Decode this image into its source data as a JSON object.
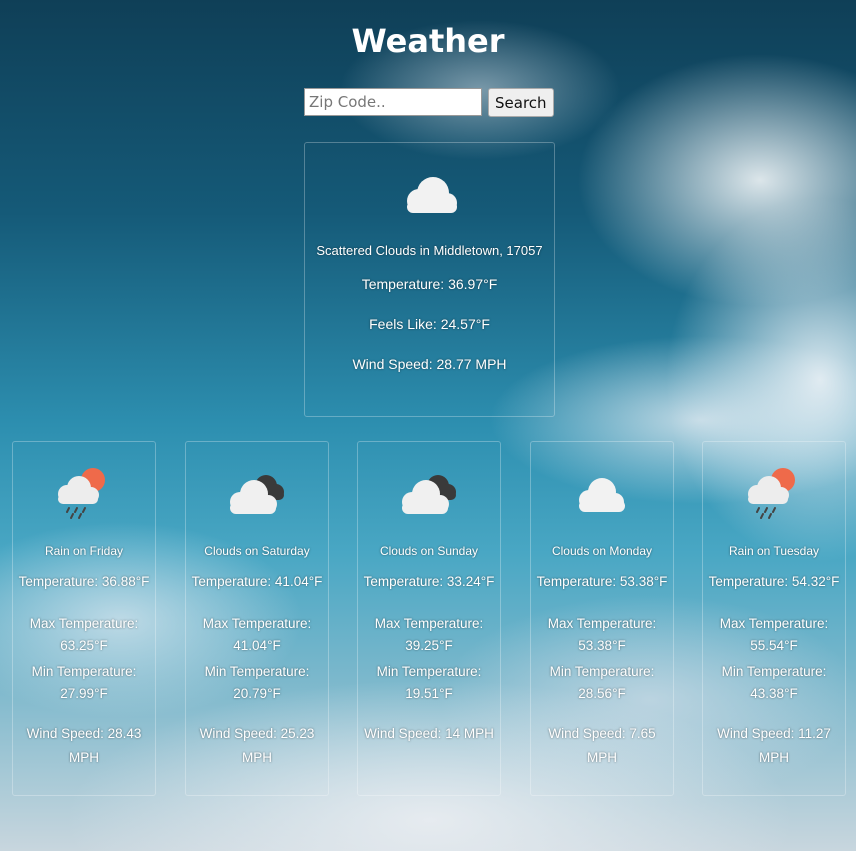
{
  "app": {
    "title": "Weather"
  },
  "search": {
    "placeholder": "Zip Code..",
    "button_label": "Search"
  },
  "current": {
    "icon": "cloud-icon",
    "condition": "Scattered Clouds in Middletown, 17057",
    "temperature": "Temperature: 36.97°F",
    "feels_like": "Feels Like: 24.57°F",
    "wind_speed": "Wind Speed: 28.77 MPH"
  },
  "forecast": [
    {
      "icon": "rain-sun-icon",
      "condition": "Rain on Friday",
      "temperature": "Temperature: 36.88°F",
      "max_label": "Max Temperature:",
      "max_value": "63.25°F",
      "min_label": "Min Temperature:",
      "min_value": "27.99°F",
      "wind_label": "Wind Speed: 28.43",
      "wind_unit": "MPH"
    },
    {
      "icon": "dark-clouds-icon",
      "condition": "Clouds on Saturday",
      "temperature": "Temperature: 41.04°F",
      "max_label": "Max Temperature:",
      "max_value": "41.04°F",
      "min_label": "Min Temperature:",
      "min_value": "20.79°F",
      "wind_label": "Wind Speed: 25.23",
      "wind_unit": "MPH"
    },
    {
      "icon": "dark-clouds-icon",
      "condition": "Clouds on Sunday",
      "temperature": "Temperature: 33.24°F",
      "max_label": "Max Temperature:",
      "max_value": "39.25°F",
      "min_label": "Min Temperature:",
      "min_value": "19.51°F",
      "wind_label": "Wind Speed: 14 MPH",
      "wind_unit": ""
    },
    {
      "icon": "cloud-icon",
      "condition": "Clouds on Monday",
      "temperature": "Temperature: 53.38°F",
      "max_label": "Max Temperature:",
      "max_value": "53.38°F",
      "min_label": "Min Temperature:",
      "min_value": "28.56°F",
      "wind_label": "Wind Speed: 7.65",
      "wind_unit": "MPH"
    },
    {
      "icon": "rain-sun-icon",
      "condition": "Rain on Tuesday",
      "temperature": "Temperature: 54.32°F",
      "max_label": "Max Temperature:",
      "max_value": "55.54°F",
      "min_label": "Min Temperature:",
      "min_value": "43.38°F",
      "wind_label": "Wind Speed: 11.27",
      "wind_unit": "MPH"
    }
  ]
}
